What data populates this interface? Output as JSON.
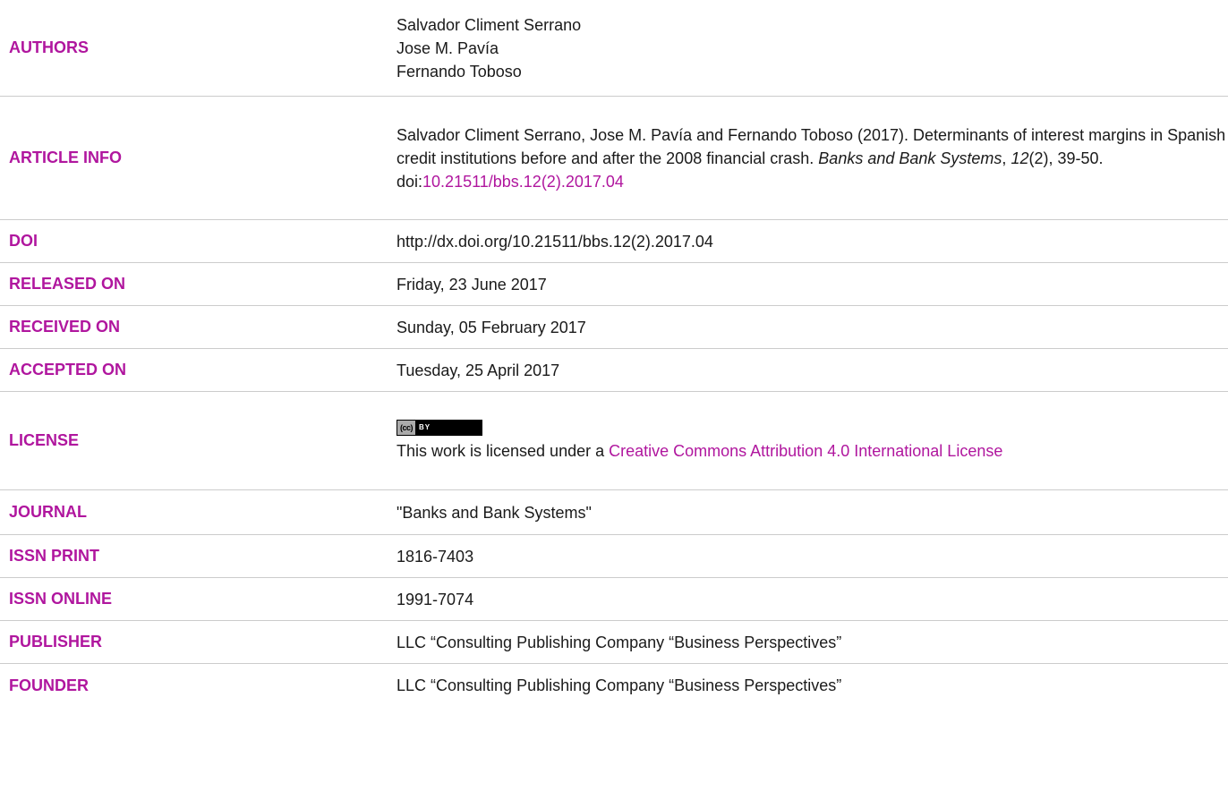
{
  "rows": {
    "authors": {
      "label": "AUTHORS",
      "names": [
        "Salvador Climent Serrano",
        "Jose M. Pavía",
        "Fernando Toboso"
      ]
    },
    "article_info": {
      "label": "ARTICLE INFO",
      "citation_text": "Salvador Climent Serrano, Jose M. Pavía and Fernando Toboso (2017). Determinants of interest margins in Spanish credit institutions before and after the 2008 financial crash.",
      "journal_italic": "Banks and Bank Systems",
      "comma": ",",
      "volume_italic": "12",
      "issue_pages": "(2), 39-50.",
      "doi_prefix": "doi:",
      "doi_link": "10.21511/bbs.12(2).2017.04"
    },
    "doi": {
      "label": "DOI",
      "value": "http://dx.doi.org/10.21511/bbs.12(2).2017.04"
    },
    "released_on": {
      "label": "RELEASED ON",
      "value": "Friday, 23 June 2017"
    },
    "received_on": {
      "label": "RECEIVED ON",
      "value": "Sunday, 05 February 2017"
    },
    "accepted_on": {
      "label": "ACCEPTED ON",
      "value": "Tuesday, 25 April 2017"
    },
    "license": {
      "label": "LICENSE",
      "badge_cc": "(cc)",
      "badge_by": "BY",
      "text": "This work is licensed under a ",
      "link": "Creative Commons Attribution 4.0 International License"
    },
    "journal": {
      "label": "JOURNAL",
      "value": "\"Banks and Bank Systems\""
    },
    "issn_print": {
      "label": "ISSN PRINT",
      "value": "1816-7403"
    },
    "issn_online": {
      "label": "ISSN ONLINE",
      "value": "1991-7074"
    },
    "publisher": {
      "label": "PUBLISHER",
      "value": "LLC “Consulting Publishing Company “Business Perspectives”"
    },
    "founder": {
      "label": "FOUNDER",
      "value": "LLC “Consulting Publishing Company “Business Perspectives”"
    }
  },
  "colors": {
    "label": "#b0169e",
    "text": "#1a1a1a",
    "divider": "#cccccc"
  }
}
